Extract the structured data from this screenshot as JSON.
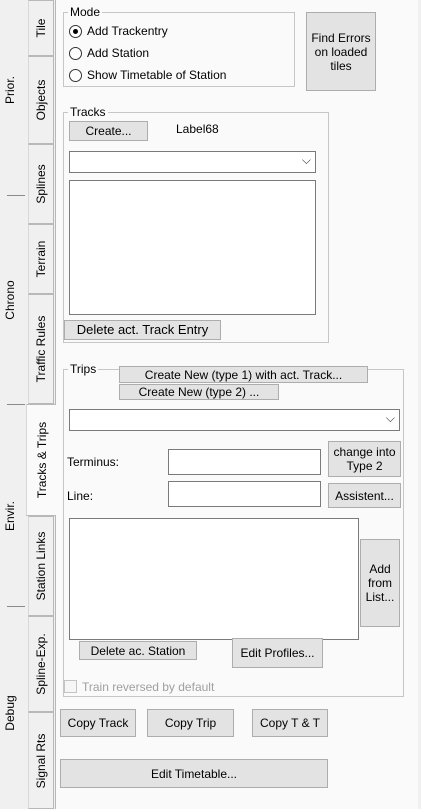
{
  "tabs": [
    {
      "label": "Tile"
    },
    {
      "label": "Objects"
    },
    {
      "label": "Splines"
    },
    {
      "label": "Terrain"
    },
    {
      "label": "Traffic Rules"
    },
    {
      "label": "Tracks & Trips"
    },
    {
      "label": "Station Links"
    },
    {
      "label": "Spline-Exp."
    },
    {
      "label": "Signal Rts"
    }
  ],
  "groups": [
    {
      "label": "Prior."
    },
    {
      "label": "Chrono"
    },
    {
      "label": "Envir."
    },
    {
      "label": "Debug"
    }
  ],
  "mode": {
    "legend": "Mode",
    "options": [
      "Add Trackentry",
      "Add Station",
      "Show Timetable of Station"
    ],
    "selected": "Add Trackentry"
  },
  "find_errors_label": "Find Errors on loaded tiles",
  "tracks": {
    "legend": "Tracks",
    "create_label": "Create...",
    "label68": "Label68",
    "delete_label": "Delete act. Track Entry",
    "combo_value": ""
  },
  "trips": {
    "legend": "Trips",
    "create_type1_label": "Create New  (type 1) with act. Track...",
    "create_type2_label": "Create New  (type 2) ...",
    "terminus_label": "Terminus:",
    "terminus_value": "",
    "line_label": "Line:",
    "line_value": "",
    "change_type_label": "change into Type 2",
    "assistent_label": "Assistent...",
    "add_from_list_label": "Add from List...",
    "delete_station_label": "Delete ac. Station",
    "edit_profiles_label": "Edit Profiles...",
    "train_reversed_label": "Train reversed by default",
    "train_reversed_checked": false
  },
  "bottom": {
    "copy_track_label": "Copy Track",
    "copy_trip_label": "Copy Trip",
    "copy_tt_label": "Copy T & T",
    "edit_timetable_label": "Edit Timetable..."
  },
  "colors": {
    "page_bg": "#fafafa",
    "window_bg": "#f0f0f0",
    "button_bg": "#e3e3e3",
    "border": "#adadad"
  }
}
